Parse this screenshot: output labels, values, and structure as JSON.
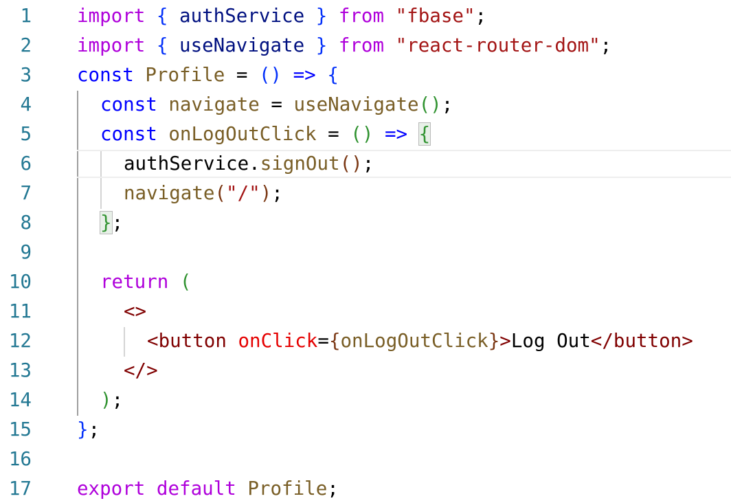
{
  "line_numbers": [
    "1",
    "2",
    "3",
    "4",
    "5",
    "6",
    "7",
    "8",
    "9",
    "10",
    "11",
    "12",
    "13",
    "14",
    "15",
    "16",
    "17"
  ],
  "code": {
    "l1": [
      "import",
      " { ",
      "authService",
      " } ",
      "from",
      " ",
      "\"fbase\"",
      ";"
    ],
    "l2": [
      "import",
      " { ",
      "useNavigate",
      " } ",
      "from",
      " ",
      "\"react-router-dom\"",
      ";"
    ],
    "l3": [
      "const",
      " ",
      "Profile",
      " = ",
      "()",
      " ",
      "=>",
      " ",
      "{"
    ],
    "l4": [
      "const",
      " ",
      "navigate",
      " = ",
      "useNavigate",
      "()",
      ";"
    ],
    "l5": [
      "const",
      " ",
      "onLogOutClick",
      " = ",
      "()",
      " ",
      "=>",
      " ",
      "{"
    ],
    "l6": [
      "authService",
      ".",
      "signOut",
      "()",
      ";"
    ],
    "l7": [
      "navigate",
      "(",
      "\"/\"",
      ")",
      ";"
    ],
    "l8": [
      "}",
      ";"
    ],
    "l10": [
      "return",
      " ",
      "("
    ],
    "l11": [
      "<>"
    ],
    "l12": [
      "<",
      "button",
      " ",
      "onClick",
      "=",
      "{",
      "onLogOutClick",
      "}",
      ">",
      "Log Out",
      "</",
      "button",
      ">"
    ],
    "l13": [
      "</>"
    ],
    "l14": [
      ")",
      ";"
    ],
    "l15": [
      "}",
      ";"
    ],
    "l17": [
      "export",
      " ",
      "default",
      " ",
      "Profile",
      ";"
    ]
  }
}
